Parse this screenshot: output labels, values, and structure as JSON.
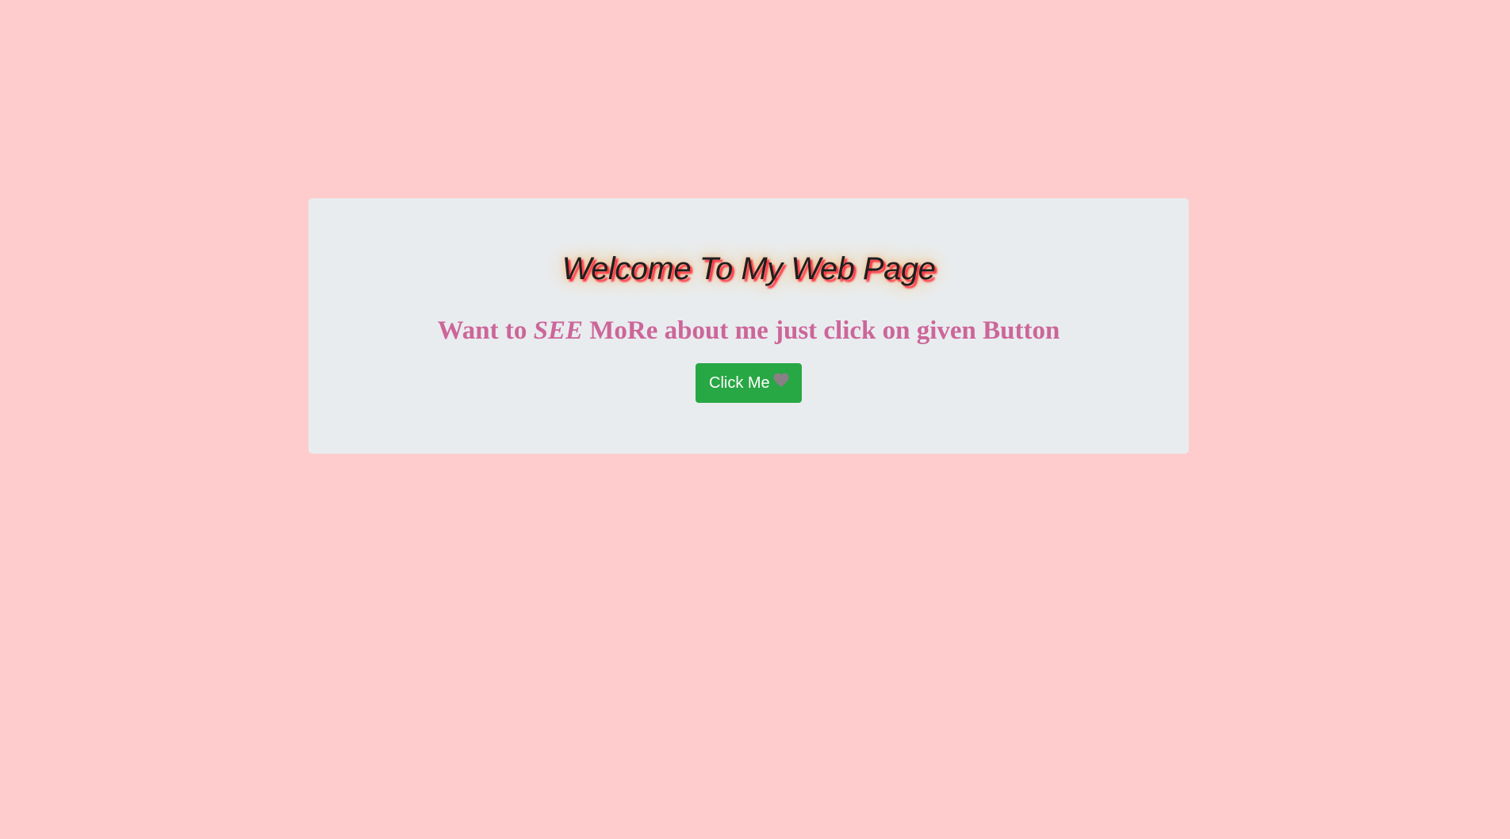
{
  "page": {
    "background_color": "#ffcccd"
  },
  "hero": {
    "title": "Welcome To My Web Page",
    "subtitle_prefix": "Want to ",
    "subtitle_emphasis": "SEE",
    "subtitle_suffix": " MoRe about me just click on given Button",
    "button_label": "Click Me",
    "button_icon": "heart-icon",
    "colors": {
      "panel": "#e9ecef",
      "title_text": "#1f1f1f",
      "title_shadow": "#ff2a3c",
      "subtitle_text": "#cc6699",
      "button": "#28a745",
      "button_text": "#ffffff",
      "icon": "#8a7f86"
    }
  }
}
